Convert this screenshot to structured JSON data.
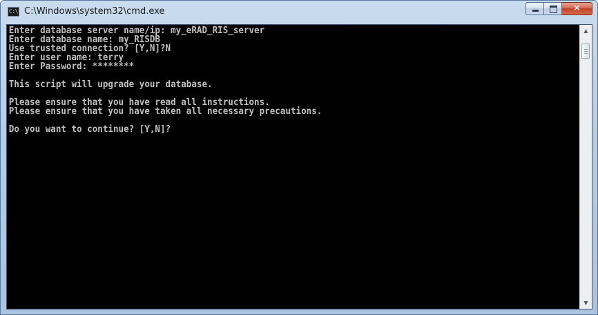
{
  "window": {
    "title": "C:\\Windows\\system32\\cmd.exe",
    "icon_text": "C:\\"
  },
  "caption_buttons": {
    "minimize_icon": "minimize-icon",
    "maximize_icon": "maximize-icon",
    "close_icon": "close-icon",
    "close_glyph": "✕"
  },
  "console": {
    "text": "Enter database server name/ip: my_eRAD_RIS_server\nEnter database name: my_RISDB\nUse trusted connection? [Y,N]?N\nEnter user name: terry\nEnter Password: ********\n\nThis script will upgrade your database.\n\nPlease ensure that you have read all instructions.\nPlease ensure that you have taken all necessary precautions.\n\nDo you want to continue? [Y,N]?"
  },
  "scrollbar": {
    "up_arrow": "▲",
    "down_arrow": "▼",
    "position_fraction": 0.0
  },
  "colors": {
    "console_bg": "#000000",
    "console_fg": "#c0c0c0",
    "close_button": "#c2402a",
    "titlebar": "#b6cde6"
  }
}
